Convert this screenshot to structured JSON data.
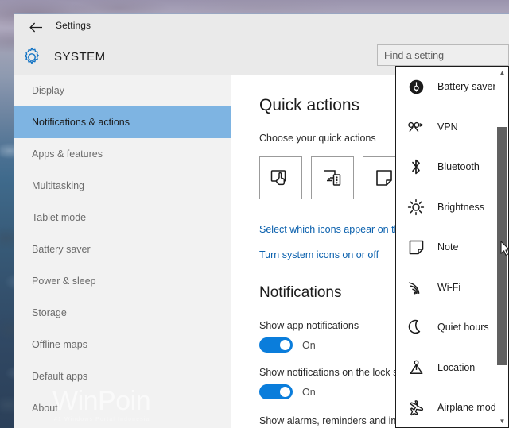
{
  "window": {
    "back_label": "back-arrow",
    "title": "Settings",
    "section_title": "SYSTEM"
  },
  "search": {
    "placeholder": "Find a setting",
    "value": ""
  },
  "sidebar": {
    "items": [
      {
        "label": "Display",
        "selected": false
      },
      {
        "label": "Notifications & actions",
        "selected": true
      },
      {
        "label": "Apps & features",
        "selected": false
      },
      {
        "label": "Multitasking",
        "selected": false
      },
      {
        "label": "Tablet mode",
        "selected": false
      },
      {
        "label": "Battery saver",
        "selected": false
      },
      {
        "label": "Power & sleep",
        "selected": false
      },
      {
        "label": "Storage",
        "selected": false
      },
      {
        "label": "Offline maps",
        "selected": false
      },
      {
        "label": "Default apps",
        "selected": false
      },
      {
        "label": "About",
        "selected": false
      }
    ]
  },
  "watermark": {
    "main": "WinPoin",
    "sub": "#1 Windows Portal Indonesia"
  },
  "main": {
    "quick_actions": {
      "heading": "Quick actions",
      "subheading": "Choose your quick actions",
      "tiles": [
        {
          "icon": "tablet-mode-icon"
        },
        {
          "icon": "connect-project-icon"
        },
        {
          "icon": "note-icon"
        }
      ],
      "links": [
        "Select which icons appear on the",
        "Turn system icons on or off"
      ]
    },
    "notifications": {
      "heading": "Notifications",
      "settings": [
        {
          "label": "Show app notifications",
          "state": "On"
        },
        {
          "label": "Show notifications on the lock scr",
          "state": "On"
        }
      ],
      "trailing_label": "Show alarms, reminders and incor\nscreen"
    }
  },
  "flyout": {
    "items": [
      {
        "label": "Battery saver",
        "icon": "battery-saver-icon"
      },
      {
        "label": "VPN",
        "icon": "vpn-icon"
      },
      {
        "label": "Bluetooth",
        "icon": "bluetooth-icon"
      },
      {
        "label": "Brightness",
        "icon": "brightness-icon"
      },
      {
        "label": "Note",
        "icon": "note-icon"
      },
      {
        "label": "Wi-Fi",
        "icon": "wifi-icon"
      },
      {
        "label": "Quiet hours",
        "icon": "moon-icon"
      },
      {
        "label": "Location",
        "icon": "location-icon"
      },
      {
        "label": "Airplane mode",
        "icon": "airplane-icon"
      }
    ],
    "scroll_up": "▲",
    "scroll_down": "▼"
  },
  "colors": {
    "accent": "#0a7ddb",
    "selection": "#7eb4e2",
    "link": "#0a60ad",
    "chrome": "#eaeaea",
    "sidebar": "#f2f2f2"
  }
}
